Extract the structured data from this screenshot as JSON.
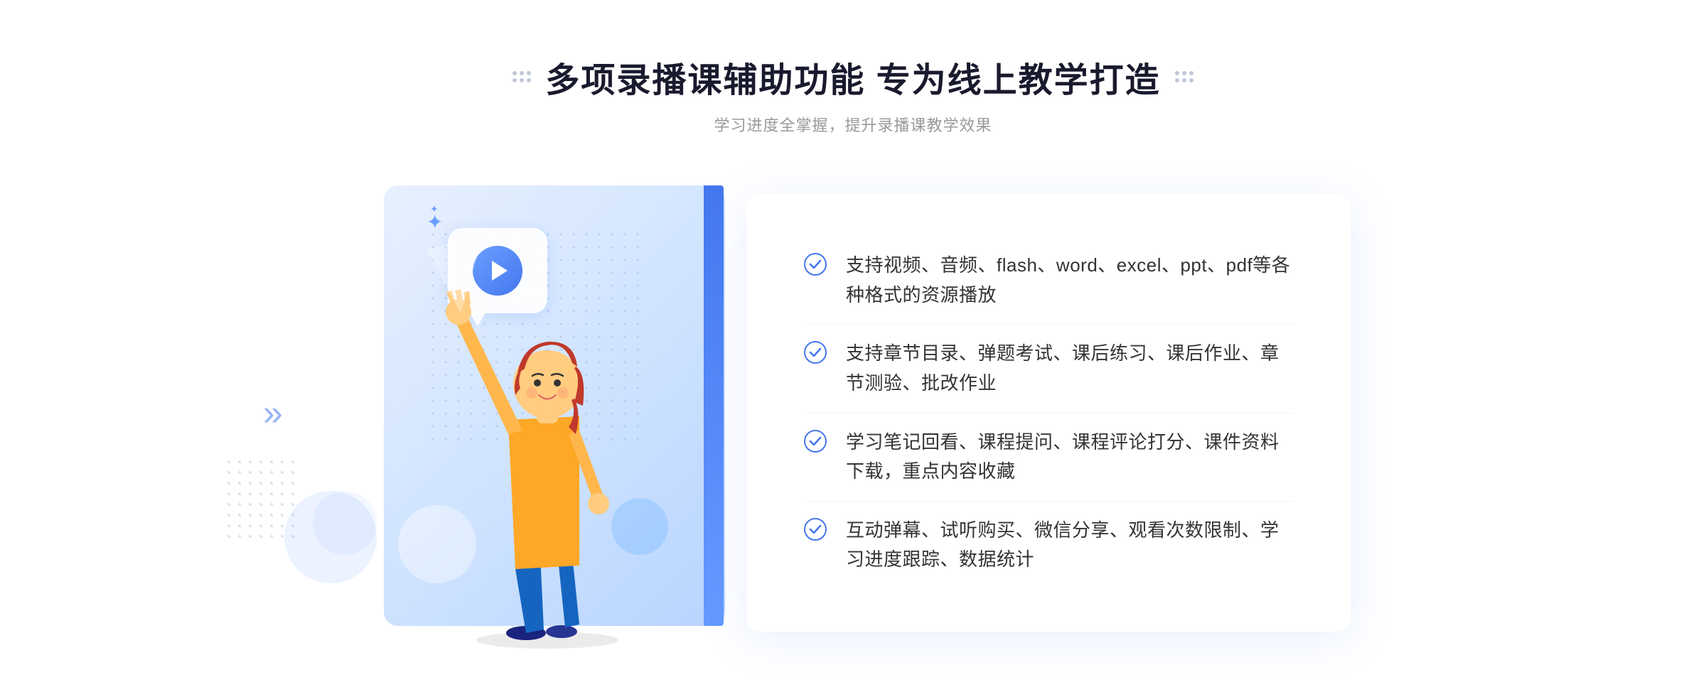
{
  "header": {
    "title": "多项录播课辅助功能 专为线上教学打造",
    "subtitle": "学习进度全掌握，提升录播课教学效果"
  },
  "features": [
    {
      "id": "feature-1",
      "text": "支持视频、音频、flash、word、excel、ppt、pdf等各种格式的资源播放"
    },
    {
      "id": "feature-2",
      "text": "支持章节目录、弹题考试、课后练习、课后作业、章节测验、批改作业"
    },
    {
      "id": "feature-3",
      "text": "学习笔记回看、课程提问、课程评论打分、课件资料下载，重点内容收藏"
    },
    {
      "id": "feature-4",
      "text": "互动弹幕、试听购买、微信分享、观看次数限制、学习进度跟踪、数据统计"
    }
  ],
  "decorations": {
    "chevron_symbol": "»",
    "play_circle": "▶",
    "check_symbol": "✓"
  },
  "colors": {
    "primary_blue": "#4477ee",
    "light_blue": "#e8f0fe",
    "text_dark": "#1a1a2e",
    "text_gray": "#999999",
    "text_body": "#333333"
  }
}
